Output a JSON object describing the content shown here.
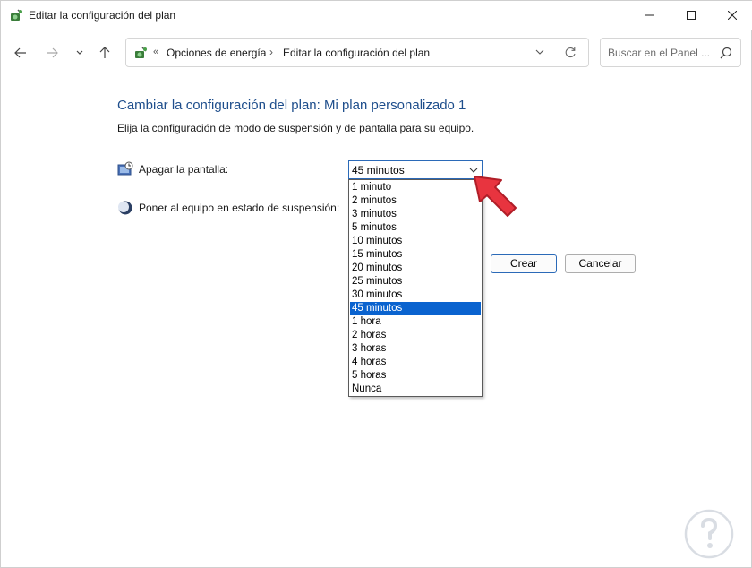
{
  "window": {
    "title": "Editar la configuración del plan"
  },
  "nav": {
    "back_icon": "arrow-left-icon",
    "forward_icon": "arrow-right-icon",
    "recent_icon": "chevron-down-icon",
    "up_icon": "arrow-up-icon"
  },
  "address": {
    "chevron": "«",
    "crumb1": "Opciones de energía",
    "separator": "›",
    "crumb2": "Editar la configuración del plan"
  },
  "search": {
    "placeholder": "Buscar en el Panel ..."
  },
  "main": {
    "heading": "Cambiar la configuración del plan: Mi plan personalizado 1",
    "subtitle": "Elija la configuración de modo de suspensión y de pantalla para su equipo.",
    "display_label": "Apagar la pantalla:",
    "sleep_label": "Poner al equipo en estado de suspensión:",
    "display_value": "45 minutos",
    "options": [
      "1 minuto",
      "2 minutos",
      "3 minutos",
      "5 minutos",
      "10 minutos",
      "15 minutos",
      "20 minutos",
      "25 minutos",
      "30 minutos",
      "45 minutos",
      "1 hora",
      "2 horas",
      "3 horas",
      "4 horas",
      "5 horas",
      "Nunca"
    ],
    "selected_option": "45 minutos"
  },
  "buttons": {
    "create": "Crear",
    "cancel": "Cancelar"
  },
  "colors": {
    "heading": "#1e4e8c",
    "selection": "#0a63cf",
    "pointer": "#e8343f"
  }
}
